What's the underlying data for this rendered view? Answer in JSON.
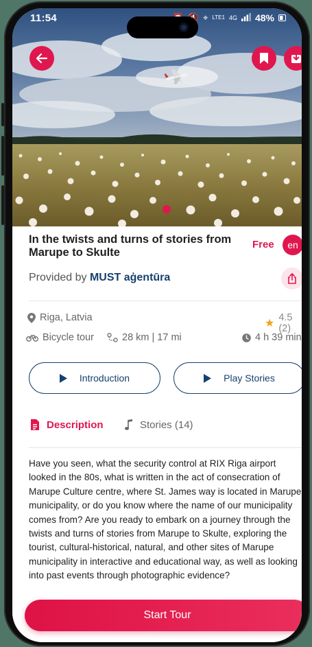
{
  "status_bar": {
    "time": "11:54",
    "network": "LTE1",
    "network_type": "4G",
    "battery": "48%"
  },
  "tour": {
    "title": "In the twists and turns of stories from Marupe to Skulte",
    "price": "Free",
    "language": "en",
    "provided_prefix": "Provided by",
    "provider": "MUST aģentūra",
    "location": "Riga, Latvia",
    "rating": "4.5 (2)",
    "rating_value": 4.5,
    "tour_type": "Bicycle tour",
    "distance": "28 km | 17 mi",
    "duration": "4 h 39 min"
  },
  "buttons": {
    "introduction": "Introduction",
    "play_stories": "Play Stories",
    "start_tour": "Start Tour"
  },
  "tabs": {
    "description": "Description",
    "stories": "Stories (14)"
  },
  "description": "Have you seen, what the security control at RIX Riga airport looked in the 80s, what is written in the act of consecration of Marupe Culture centre, where St. James way is located in Marupe municipality, or do you know where the name of our municipality comes from? Are you ready to embark on a journey through the twists and turns of stories from Marupe to Skulte, exploring the tourist, cultural-historical, natural, and other sites of Marupe municipality in interactive and educational way, as well as looking into past events through photographic evidence?",
  "colors": {
    "accent": "#e0174e",
    "navy": "#17406e",
    "background": "#4f7666"
  },
  "icons": {
    "back": "arrow-left-icon",
    "bookmark": "bookmark-icon",
    "download": "download-icon",
    "share": "share-icon",
    "location": "map-pin-icon",
    "star": "star-icon",
    "bike": "bicycle-icon",
    "route": "route-icon",
    "clock": "clock-icon",
    "play": "play-icon",
    "description": "document-icon",
    "stories": "music-note-icon"
  }
}
